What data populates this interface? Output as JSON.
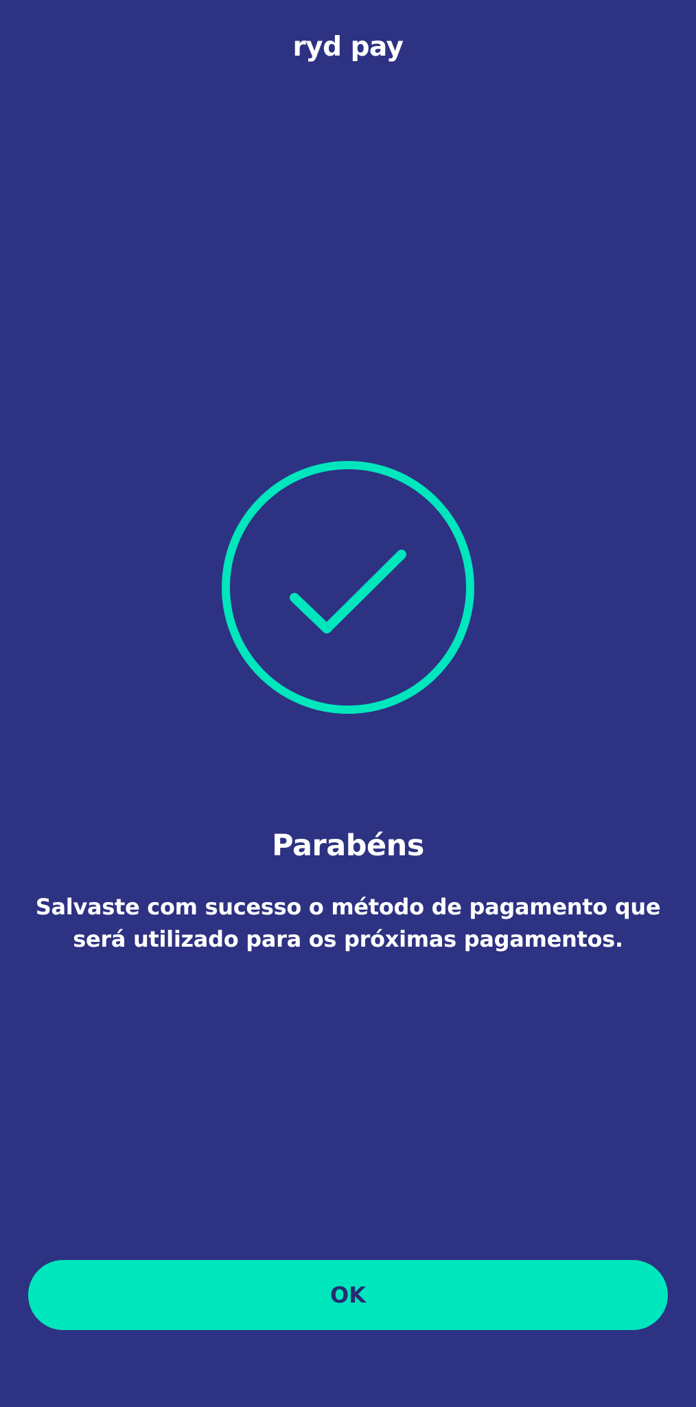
{
  "header": {
    "title": "ryd pay"
  },
  "success": {
    "icon": "checkmark-circle-icon",
    "headline": "Parabéns",
    "message": "Salvaste com sucesso o método de pagamento que será utilizado para os próximas pagamentos."
  },
  "actions": {
    "ok_label": "OK"
  },
  "colors": {
    "background": "#2d3282",
    "accent": "#00e6bd",
    "text": "#ffffff",
    "button_text": "#262c72"
  }
}
